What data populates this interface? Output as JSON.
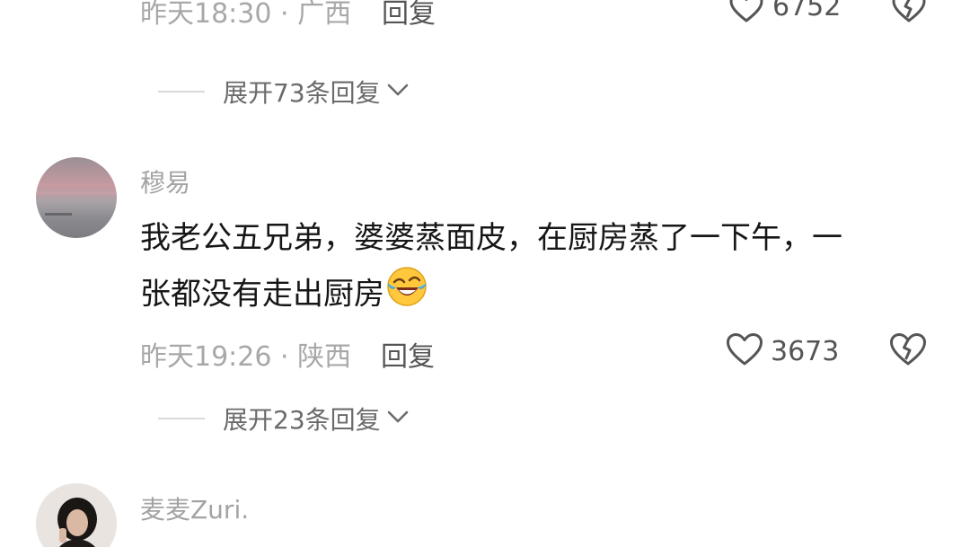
{
  "top_partial": {
    "meta": "昨天18:30 · 广西",
    "reply_label": "回复",
    "like_count": "6752"
  },
  "expand_1": {
    "label": "展开73条回复"
  },
  "comment_1": {
    "username": "穆易",
    "text_line1": "我老公五兄弟，婆婆蒸面皮，在厨房蒸了一下午，一",
    "text_line2": "张都没有走出厨房",
    "emoji_icon": "rolling-laughing-emoji",
    "time_location": "昨天19:26 · 陕西",
    "reply_label": "回复",
    "like_count": "3673"
  },
  "expand_2": {
    "label": "展开23条回复"
  },
  "comment_2": {
    "username": "麦麦Zuri."
  }
}
